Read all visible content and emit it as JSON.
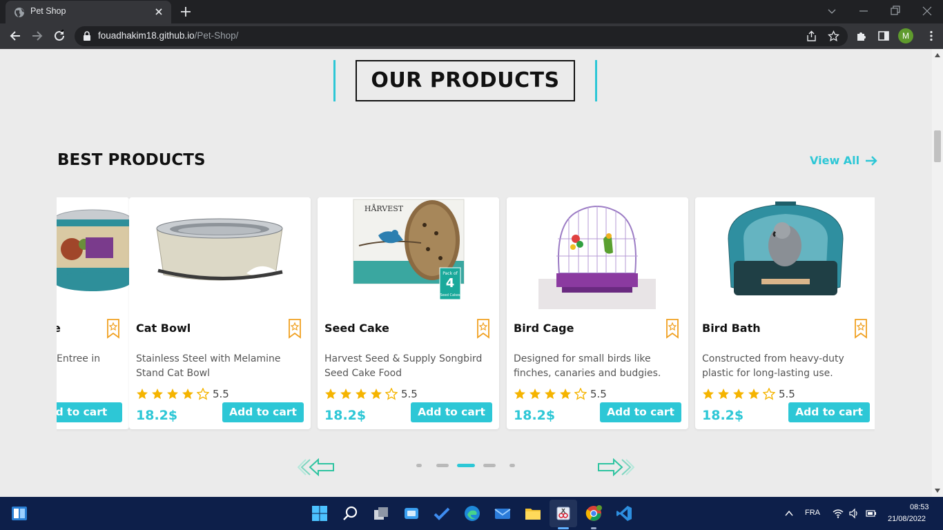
{
  "browser": {
    "tab_title": "Pet Shop",
    "url_host": "fouadhakim18.github.io",
    "url_path": "/Pet-Shop/",
    "profile_initial": "M"
  },
  "page": {
    "section_title": "OUR PRODUCTS",
    "best_title": "BEST PRODUCTS",
    "view_all": "View All",
    "accent_color": "#2dc7d6",
    "star_color": "#f5b400",
    "products": [
      {
        "name": "e",
        "desc": "Entree in",
        "rating": "",
        "price": "",
        "cart": "d to cart"
      },
      {
        "name": "Cat Bowl",
        "desc": "Stainless Steel with Melamine Stand Cat Bowl",
        "rating": "5.5",
        "price": "18.2$",
        "cart": "Add to cart"
      },
      {
        "name": "Seed Cake",
        "desc": "Harvest Seed & Supply Songbird Seed Cake Food",
        "rating": "5.5",
        "price": "18.2$",
        "cart": "Add to cart",
        "package_brand": "HÅRVEST",
        "package_badge_top": "Pack of",
        "package_badge_num": "4",
        "package_badge_bottom": "Seed Cakes"
      },
      {
        "name": "Bird Cage",
        "desc": "Designed for small birds like finches, canaries and budgies.",
        "rating": "5.5",
        "price": "18.2$",
        "cart": "Add to cart"
      },
      {
        "name": "Bird Bath",
        "desc": "Constructed from heavy-duty plastic for long-lasting use.",
        "rating": "5.5",
        "price": "18.2$",
        "cart": "Add to cart"
      }
    ],
    "stars_filled": 4,
    "stars_total": 5,
    "carousel_active_page": 3
  },
  "taskbar": {
    "language": "FRA",
    "time": "08:53",
    "date": "21/08/2022",
    "apps": [
      "start-icon",
      "search-icon",
      "task-view-icon",
      "widgets-icon",
      "todo-icon",
      "edge-icon",
      "mail-icon",
      "file-explorer-icon",
      "snipping-tool-icon",
      "chrome-icon",
      "vscode-icon"
    ]
  }
}
